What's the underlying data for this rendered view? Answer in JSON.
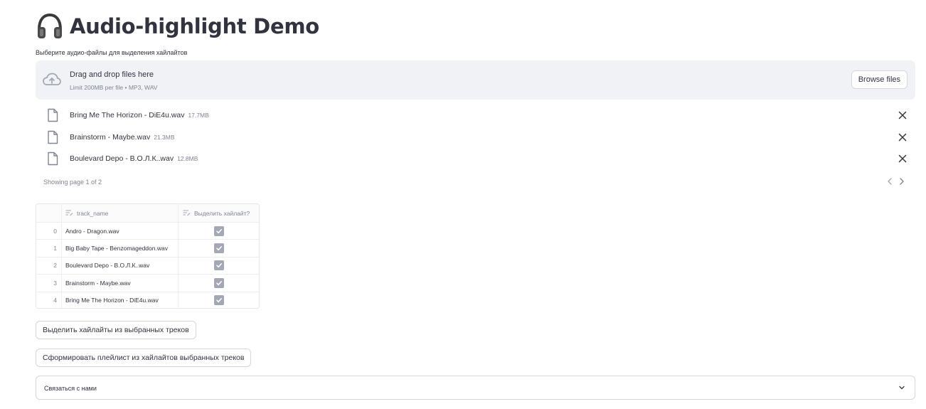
{
  "page": {
    "title": "Audio-highlight Demo",
    "title_icon": "headphones-icon"
  },
  "uploader": {
    "label": "Выберите аудио-файлы для выделения хайлайтов",
    "dropzone_title": "Drag and drop files here",
    "dropzone_limit": "Limit 200MB per file • MP3, WAV",
    "browse_label": "Browse files",
    "files": [
      {
        "name": "Bring Me The Horizon - DiE4u.wav",
        "size": "17.7MB"
      },
      {
        "name": "Brainstorm - Maybe.wav",
        "size": "21.3MB"
      },
      {
        "name": "Boulevard Depo - В.О.Л.К..wav",
        "size": "12.8MB"
      }
    ],
    "pagination_text": "Showing page 1 of 2"
  },
  "table": {
    "columns": [
      "track_name",
      "Выделить хайлайт?"
    ],
    "rows": [
      {
        "index": "0",
        "track_name": "Andro - Dragon.wav",
        "checked": true
      },
      {
        "index": "1",
        "track_name": "Big Baby Tape - Benzomageddon.wav",
        "checked": true
      },
      {
        "index": "2",
        "track_name": "Boulevard Depo - В.О.Л.К..wav",
        "checked": true
      },
      {
        "index": "3",
        "track_name": "Brainstorm - Maybe.wav",
        "checked": true
      },
      {
        "index": "4",
        "track_name": "Bring Me The Horizon - DiE4u.wav",
        "checked": true
      }
    ]
  },
  "buttons": {
    "highlight_label": "Выделить хайлайты из выбранных треков",
    "playlist_label": "Сформировать плейлист из хайлайтов выбранных треков"
  },
  "expander": {
    "label": "Связаться с нами"
  },
  "colors": {
    "text": "#31333f",
    "muted": "#808495",
    "dropzone_bg": "#f0f2f6",
    "checkbox_fill": "#a3a8b4"
  }
}
